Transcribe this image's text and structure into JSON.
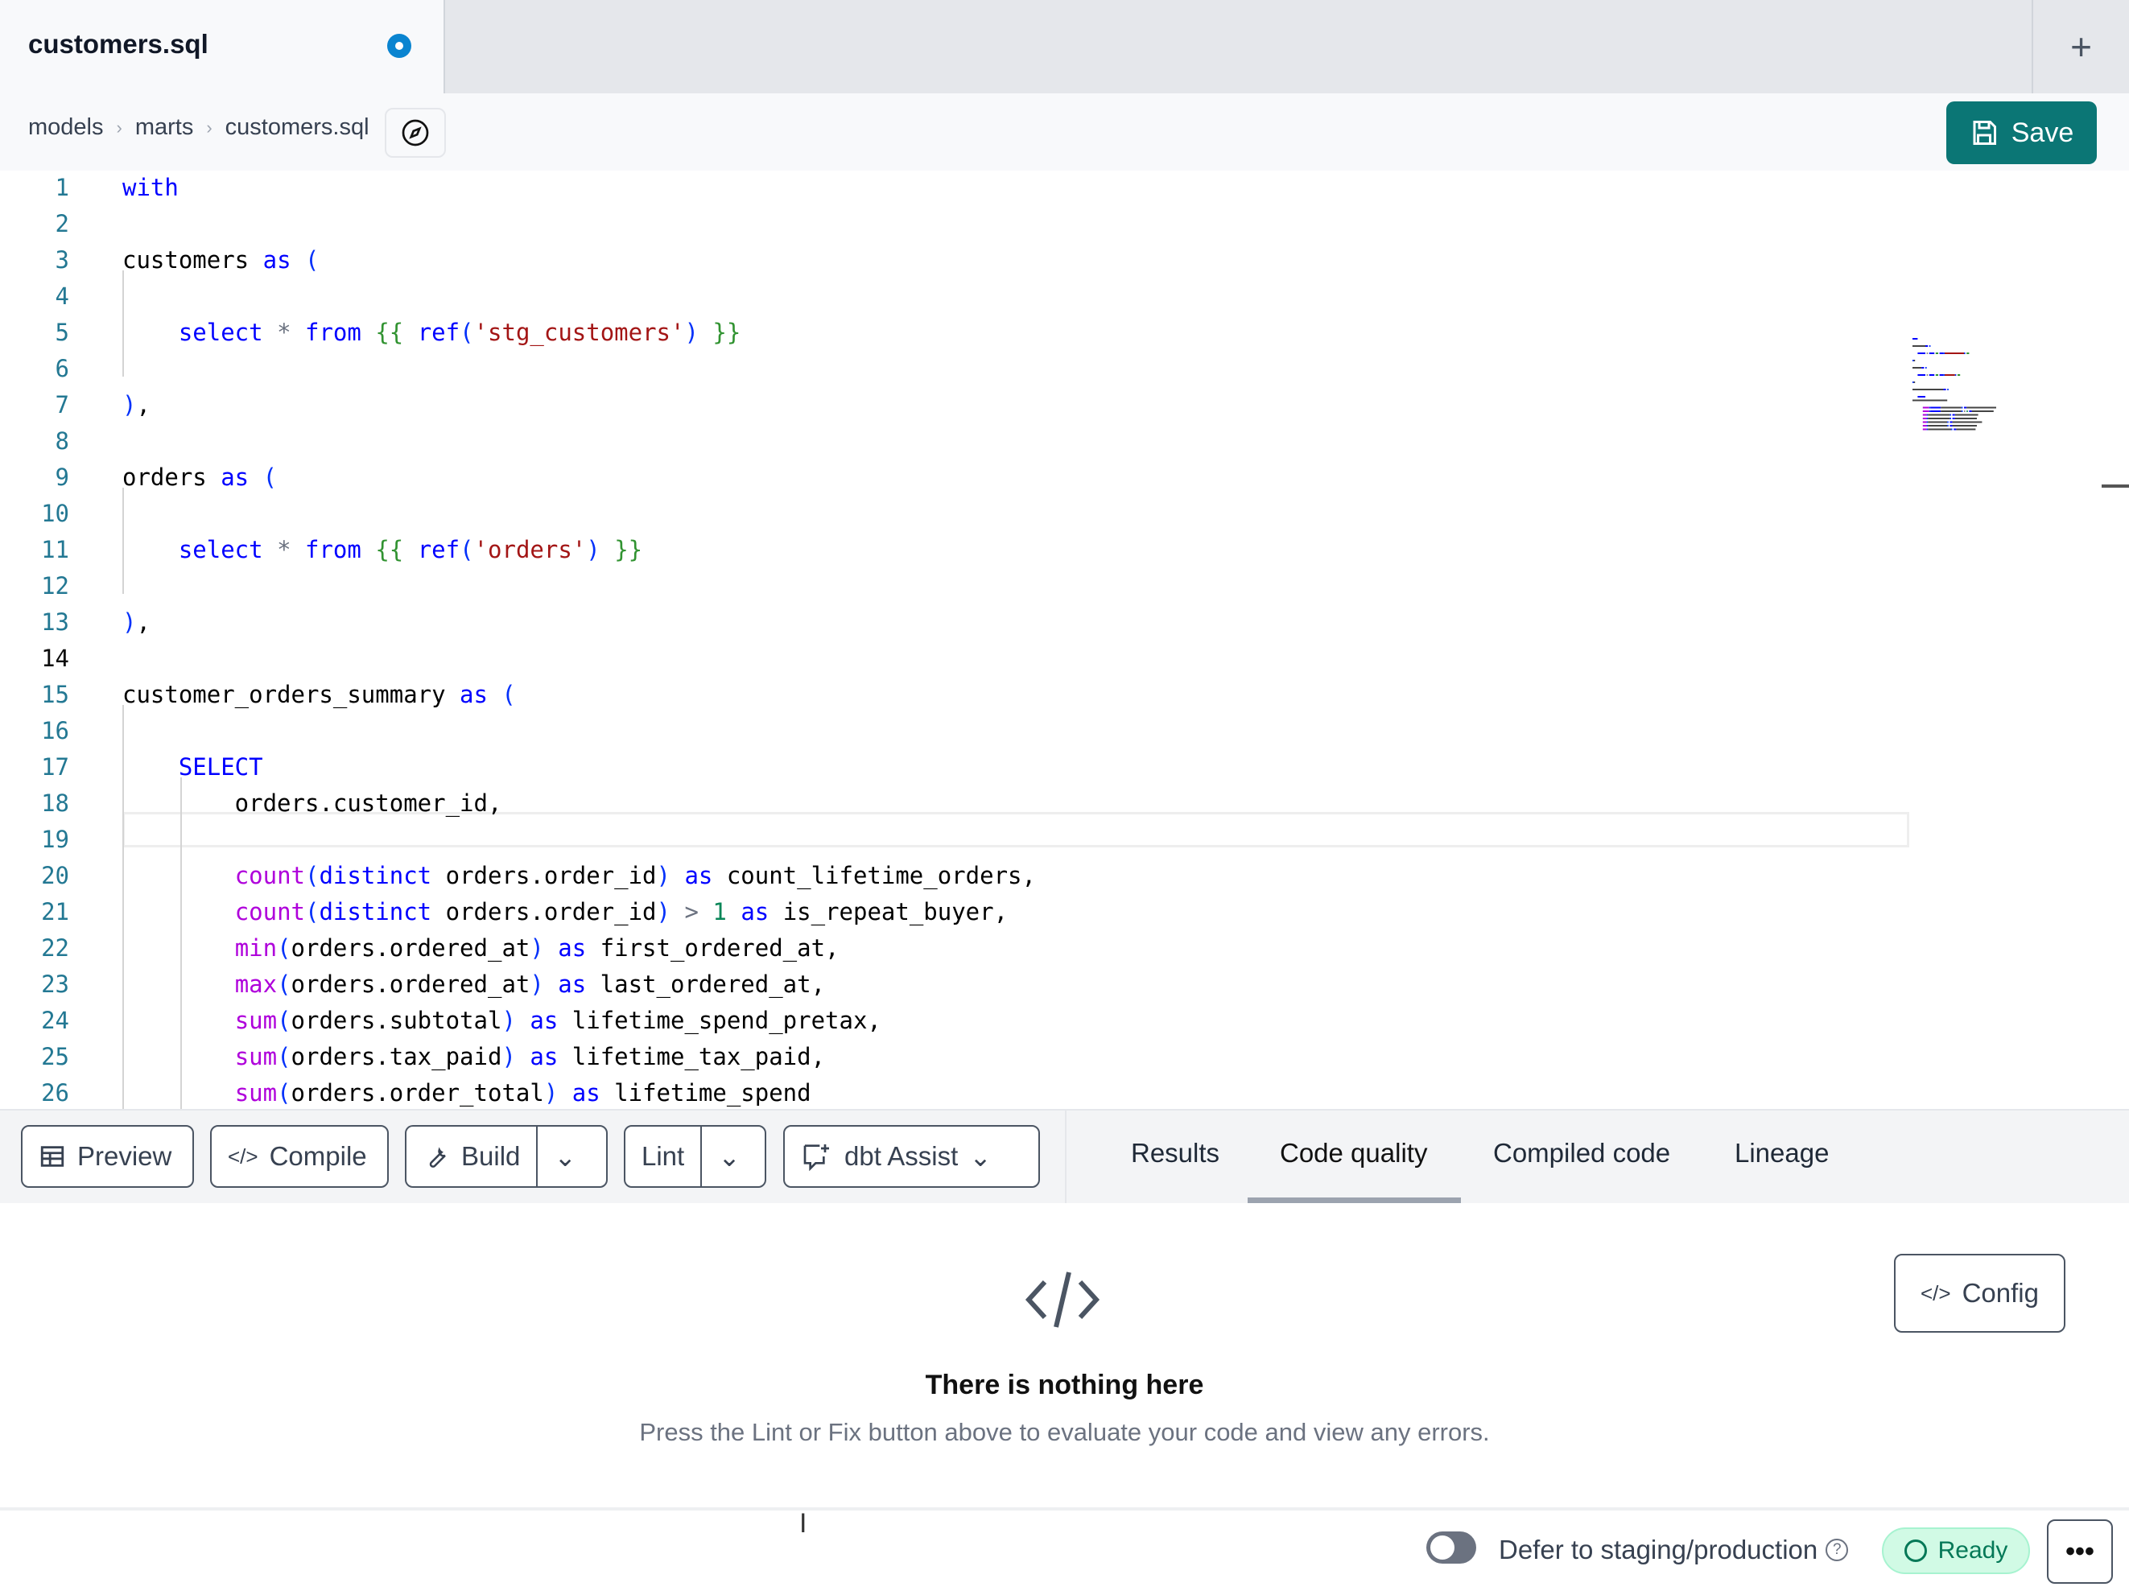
{
  "tab": {
    "title": "customers.sql",
    "unsaved": true,
    "new_tab": "+"
  },
  "breadcrumb": [
    "models",
    "marts",
    "customers.sql"
  ],
  "save_label": "Save",
  "editor": {
    "current_line": 14,
    "lines": [
      [
        [
          "k",
          "with"
        ]
      ],
      [],
      [
        [
          "t",
          "customers "
        ],
        [
          "k",
          "as"
        ],
        [
          "t",
          " "
        ],
        [
          "p",
          "("
        ]
      ],
      [],
      [
        [
          "t",
          "    "
        ],
        [
          "k",
          "select"
        ],
        [
          "t",
          " "
        ],
        [
          "o",
          "*"
        ],
        [
          "t",
          " "
        ],
        [
          "k",
          "from"
        ],
        [
          "t",
          " "
        ],
        [
          "b",
          "{{"
        ],
        [
          "t",
          " "
        ],
        [
          "k",
          "ref"
        ],
        [
          "p",
          "("
        ],
        [
          "s",
          "'stg_customers'"
        ],
        [
          "p",
          ")"
        ],
        [
          "t",
          " "
        ],
        [
          "b",
          "}}"
        ]
      ],
      [],
      [
        [
          "p",
          ")"
        ],
        [
          "t",
          ","
        ]
      ],
      [],
      [
        [
          "t",
          "orders "
        ],
        [
          "k",
          "as"
        ],
        [
          "t",
          " "
        ],
        [
          "p",
          "("
        ]
      ],
      [],
      [
        [
          "t",
          "    "
        ],
        [
          "k",
          "select"
        ],
        [
          "t",
          " "
        ],
        [
          "o",
          "*"
        ],
        [
          "t",
          " "
        ],
        [
          "k",
          "from"
        ],
        [
          "t",
          " "
        ],
        [
          "b",
          "{{"
        ],
        [
          "t",
          " "
        ],
        [
          "k",
          "ref"
        ],
        [
          "p",
          "("
        ],
        [
          "s",
          "'orders'"
        ],
        [
          "p",
          ")"
        ],
        [
          "t",
          " "
        ],
        [
          "b",
          "}}"
        ]
      ],
      [],
      [
        [
          "p",
          ")"
        ],
        [
          "t",
          ","
        ]
      ],
      [],
      [
        [
          "t",
          "customer_orders_summary "
        ],
        [
          "k",
          "as"
        ],
        [
          "t",
          " "
        ],
        [
          "p",
          "("
        ]
      ],
      [],
      [
        [
          "t",
          "    "
        ],
        [
          "k",
          "SELECT"
        ]
      ],
      [
        [
          "t",
          "        orders.customer_id,"
        ]
      ],
      [],
      [
        [
          "t",
          "        "
        ],
        [
          "f",
          "count"
        ],
        [
          "p",
          "("
        ],
        [
          "k",
          "distinct"
        ],
        [
          "t",
          " orders.order_id"
        ],
        [
          "p",
          ")"
        ],
        [
          "t",
          " "
        ],
        [
          "k",
          "as"
        ],
        [
          "t",
          " count_lifetime_orders,"
        ]
      ],
      [
        [
          "t",
          "        "
        ],
        [
          "f",
          "count"
        ],
        [
          "p",
          "("
        ],
        [
          "k",
          "distinct"
        ],
        [
          "t",
          " orders.order_id"
        ],
        [
          "p",
          ")"
        ],
        [
          "t",
          " "
        ],
        [
          "o",
          ">"
        ],
        [
          "t",
          " "
        ],
        [
          "n",
          "1"
        ],
        [
          "t",
          " "
        ],
        [
          "k",
          "as"
        ],
        [
          "t",
          " is_repeat_buyer,"
        ]
      ],
      [
        [
          "t",
          "        "
        ],
        [
          "f",
          "min"
        ],
        [
          "p",
          "("
        ],
        [
          "t",
          "orders.ordered_at"
        ],
        [
          "p",
          ")"
        ],
        [
          "t",
          " "
        ],
        [
          "k",
          "as"
        ],
        [
          "t",
          " first_ordered_at,"
        ]
      ],
      [
        [
          "t",
          "        "
        ],
        [
          "f",
          "max"
        ],
        [
          "p",
          "("
        ],
        [
          "t",
          "orders.ordered_at"
        ],
        [
          "p",
          ")"
        ],
        [
          "t",
          " "
        ],
        [
          "k",
          "as"
        ],
        [
          "t",
          " last_ordered_at,"
        ]
      ],
      [
        [
          "t",
          "        "
        ],
        [
          "f",
          "sum"
        ],
        [
          "p",
          "("
        ],
        [
          "t",
          "orders.subtotal"
        ],
        [
          "p",
          ")"
        ],
        [
          "t",
          " "
        ],
        [
          "k",
          "as"
        ],
        [
          "t",
          " lifetime_spend_pretax,"
        ]
      ],
      [
        [
          "t",
          "        "
        ],
        [
          "f",
          "sum"
        ],
        [
          "p",
          "("
        ],
        [
          "t",
          "orders.tax_paid"
        ],
        [
          "p",
          ")"
        ],
        [
          "t",
          " "
        ],
        [
          "k",
          "as"
        ],
        [
          "t",
          " lifetime_tax_paid,"
        ]
      ],
      [
        [
          "t",
          "        "
        ],
        [
          "f",
          "sum"
        ],
        [
          "p",
          "("
        ],
        [
          "t",
          "orders.order_total"
        ],
        [
          "p",
          ")"
        ],
        [
          "t",
          " "
        ],
        [
          "k",
          "as"
        ],
        [
          "t",
          " lifetime_spend"
        ]
      ]
    ]
  },
  "toolbar": {
    "preview": "Preview",
    "compile": "Compile",
    "build": "Build",
    "lint": "Lint",
    "assist": "dbt Assist"
  },
  "panel_tabs": {
    "items": [
      "Results",
      "Code quality",
      "Compiled code",
      "Lineage"
    ],
    "active": "Code quality"
  },
  "panel": {
    "title": "There is nothing here",
    "description": "Press the Lint or Fix button above to evaluate your code and view any errors.",
    "config": "Config"
  },
  "footer": {
    "defer_label": "Defer to staging/production",
    "defer_enabled": false,
    "help": "?",
    "status": "Ready",
    "more": "•••"
  },
  "colors": {
    "accent": "#0b7675",
    "status_bg": "#d1fae5",
    "status_text": "#047857",
    "unsaved_dot": "#0a84d0"
  }
}
